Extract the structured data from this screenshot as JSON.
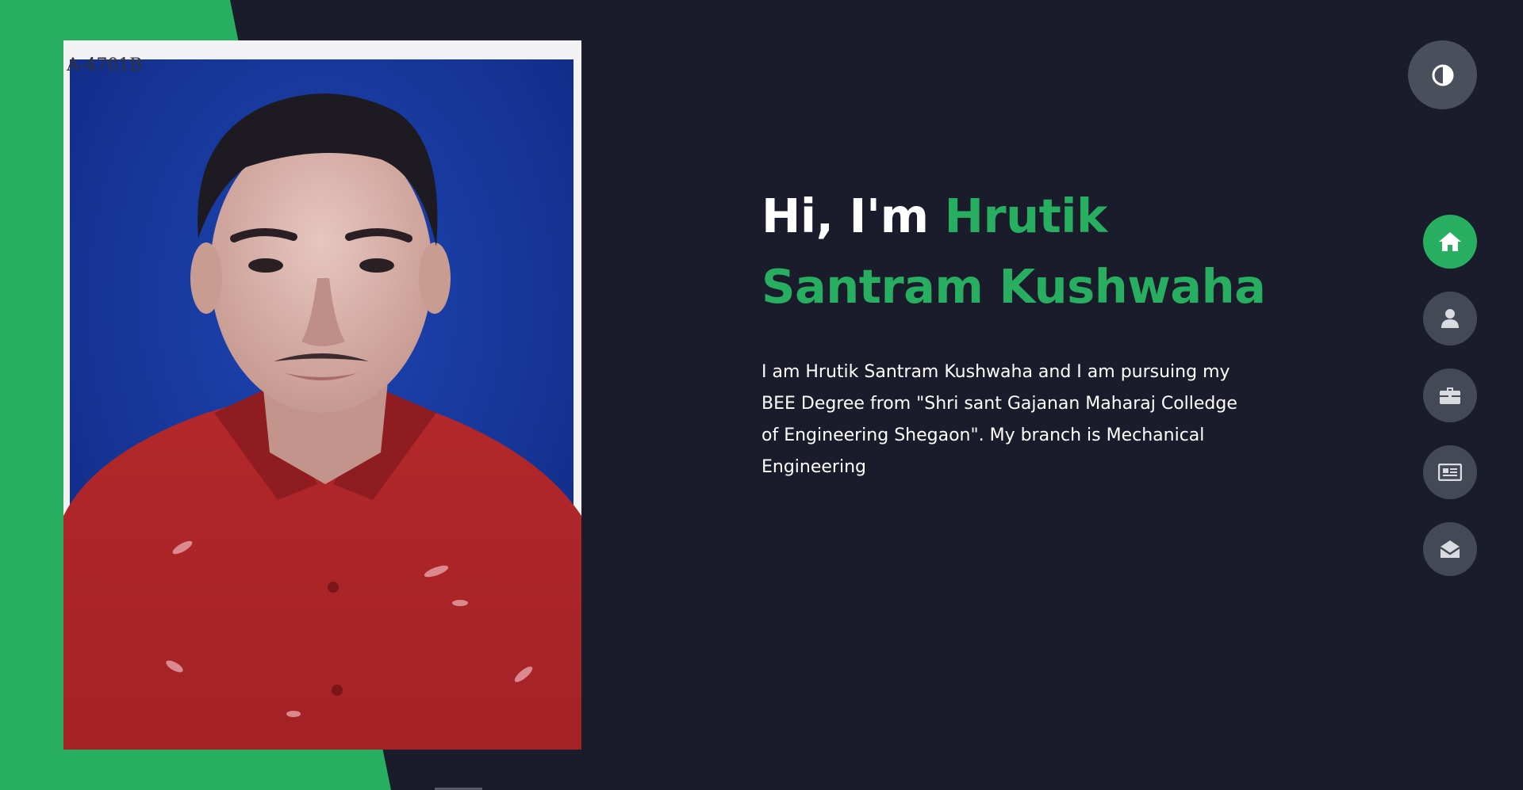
{
  "hero": {
    "greeting": "Hi, I'm",
    "name": "Hrutik Santram Kushwaha",
    "description": "I am Hrutik Santram Kushwaha and I am pursuing my BEE Degree from \"Shri sant Gajanan Maharaj Colledge of Engineering Shegaon\". My branch is Mechanical Engineering"
  },
  "photo": {
    "corner_mark": "A-4701B"
  },
  "theme_toggle": {
    "icon": "contrast-icon"
  },
  "nav": {
    "items": [
      {
        "id": "home",
        "icon": "home-icon",
        "active": true
      },
      {
        "id": "about",
        "icon": "user-icon",
        "active": false
      },
      {
        "id": "portfolio",
        "icon": "briefcase-icon",
        "active": false
      },
      {
        "id": "blogs",
        "icon": "newspaper-icon",
        "active": false
      },
      {
        "id": "contact",
        "icon": "envelope-open-icon",
        "active": false
      }
    ]
  },
  "colors": {
    "accent": "#27ae60",
    "background": "#1b1c2b",
    "button": "#444a55"
  }
}
